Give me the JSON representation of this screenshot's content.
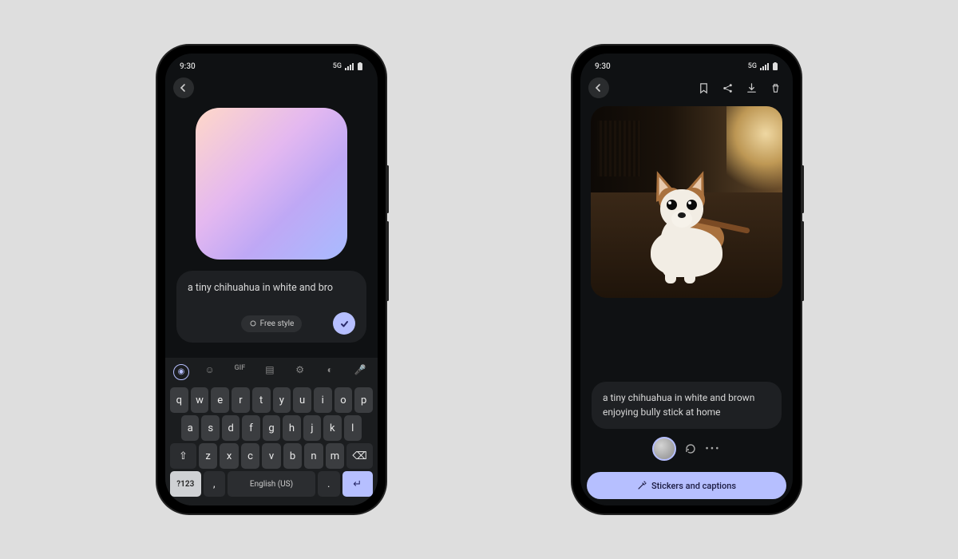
{
  "phone1": {
    "status": {
      "time": "9:30",
      "network": "5G"
    },
    "prompt_text": "a tiny chihuahua in white and bro",
    "style_chip": "Free style",
    "keyboard": {
      "row1": [
        "q",
        "w",
        "e",
        "r",
        "t",
        "y",
        "u",
        "i",
        "o",
        "p"
      ],
      "row2": [
        "a",
        "s",
        "d",
        "f",
        "g",
        "h",
        "j",
        "k",
        "l"
      ],
      "row3_shift": "⇧",
      "row3": [
        "z",
        "x",
        "c",
        "v",
        "b",
        "n",
        "m"
      ],
      "row3_back": "⌫",
      "numkey": "?123",
      "comma": ",",
      "lang": "English (US)",
      "period": ".",
      "enter": "↵"
    }
  },
  "phone2": {
    "status": {
      "time": "9:30",
      "network": "5G"
    },
    "caption": "a tiny chihuahua in white and brown enjoying bully stick at home",
    "bottom_button": "Stickers and captions"
  },
  "colors": {
    "accent": "#b6bfff"
  }
}
